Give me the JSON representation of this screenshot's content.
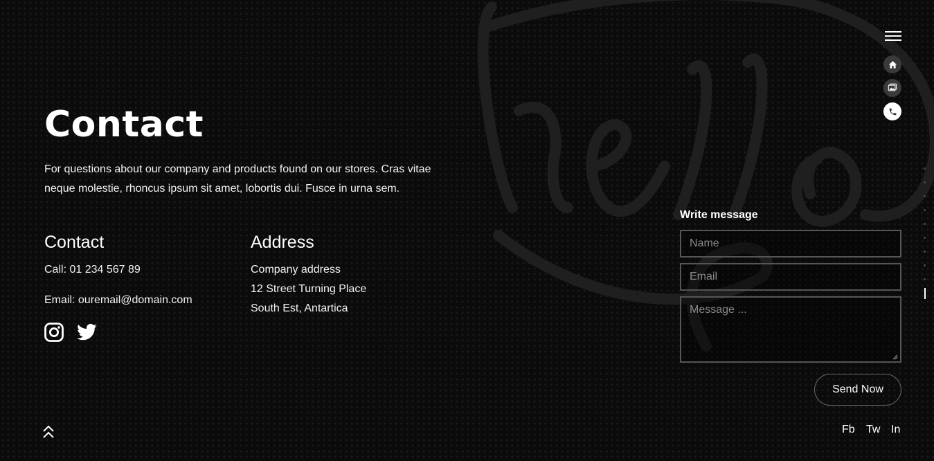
{
  "page": {
    "title": "Contact",
    "intro": "For questions about our company and products found on our stores. Cras vitae neque molestie, rhoncus ipsum sit amet, lobortis dui. Fusce in urna sem."
  },
  "contact": {
    "heading": "Contact",
    "phone": "Call: 01 234 567 89",
    "email": "Email: ouremail@domain.com",
    "social_icons": [
      "instagram-icon",
      "twitter-icon"
    ]
  },
  "address": {
    "heading": "Address",
    "lines": [
      "Company address",
      "12 Street Turning Place",
      "South Est, Antartica"
    ]
  },
  "form": {
    "title": "Write message",
    "name_placeholder": "Name",
    "email_placeholder": "Email",
    "message_placeholder": "Message ...",
    "send_label": "Send Now"
  },
  "nav": {
    "menu_icon": "hamburger-icon",
    "items": [
      {
        "icon": "home-icon",
        "active": false
      },
      {
        "icon": "gallery-icon",
        "active": false
      },
      {
        "icon": "phone-icon",
        "active": true
      }
    ]
  },
  "footer": {
    "scroll_top_icon": "double-chevron-up-icon",
    "links": [
      "Fb",
      "Tw",
      "In"
    ]
  },
  "colors": {
    "background": "#0b0b0b",
    "text": "#ffffff",
    "field_border": "#555555",
    "nav_inactive": "#3a3a3a",
    "nav_active": "#ffffff"
  }
}
